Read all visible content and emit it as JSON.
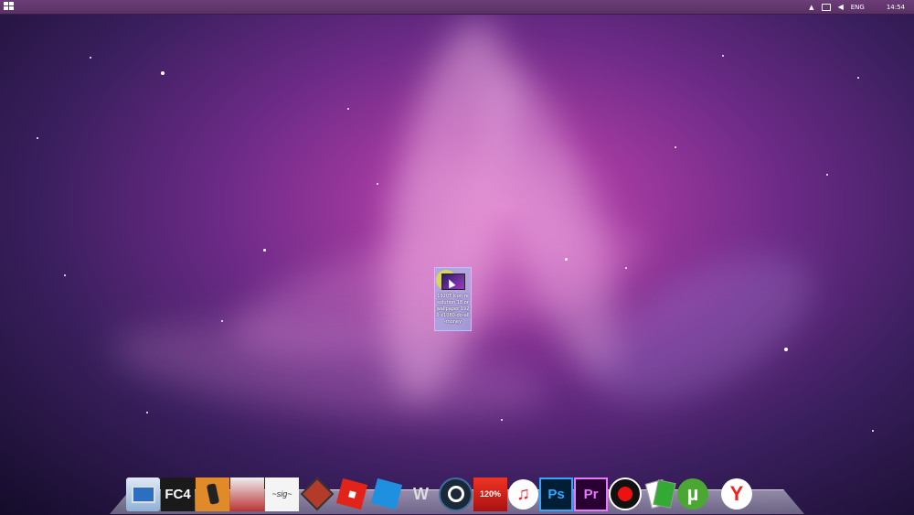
{
  "taskbar": {
    "language": "ENG",
    "clock": "14:54"
  },
  "desktop_icon": {
    "label": "1920T Icon resolution 18 or wallpaper 1920 x1080-do-all-money",
    "icon": "image-file-icon"
  },
  "dock": {
    "items": [
      {
        "name": "dock-computer",
        "icon": "computer-icon",
        "text": ""
      },
      {
        "name": "dock-far-cry-4",
        "icon": "fc4-icon",
        "text": "FC4"
      },
      {
        "name": "dock-counter-strike",
        "icon": "counter-strike-icon",
        "text": ""
      },
      {
        "name": "dock-racing-game",
        "icon": "racing-game-icon",
        "text": ""
      },
      {
        "name": "dock-signature-app",
        "icon": "signature-icon",
        "text": ""
      },
      {
        "name": "dock-game-emblem",
        "icon": "emblem-icon",
        "text": ""
      },
      {
        "name": "dock-roblox",
        "icon": "roblox-icon",
        "text": ""
      },
      {
        "name": "dock-roblox-studio",
        "icon": "roblox-studio-icon",
        "text": ""
      },
      {
        "name": "dock-world-of-tanks",
        "icon": "world-of-tanks-icon",
        "text": ""
      },
      {
        "name": "dock-steam",
        "icon": "steam-icon",
        "text": ""
      },
      {
        "name": "dock-acrobat",
        "icon": "adobe-acrobat-icon",
        "text": "120%"
      },
      {
        "name": "dock-itunes",
        "icon": "itunes-icon",
        "text": "♫"
      },
      {
        "name": "dock-photoshop",
        "icon": "photoshop-icon",
        "text": "Ps"
      },
      {
        "name": "dock-premiere",
        "icon": "premiere-icon",
        "text": "Pr"
      },
      {
        "name": "dock-recorder",
        "icon": "record-icon",
        "text": ""
      },
      {
        "name": "dock-card-game",
        "icon": "cards-icon",
        "text": ""
      },
      {
        "name": "dock-utorrent",
        "icon": "utorrent-icon",
        "text": "µ"
      },
      {
        "name": "dock-yandex",
        "icon": "yandex-browser-icon",
        "text": "Y"
      }
    ]
  },
  "colors": {
    "taskbar": "#5e3269",
    "accent_steam": "#1b2838",
    "photoshop": "#31a8ff",
    "premiere": "#ea77ff"
  }
}
